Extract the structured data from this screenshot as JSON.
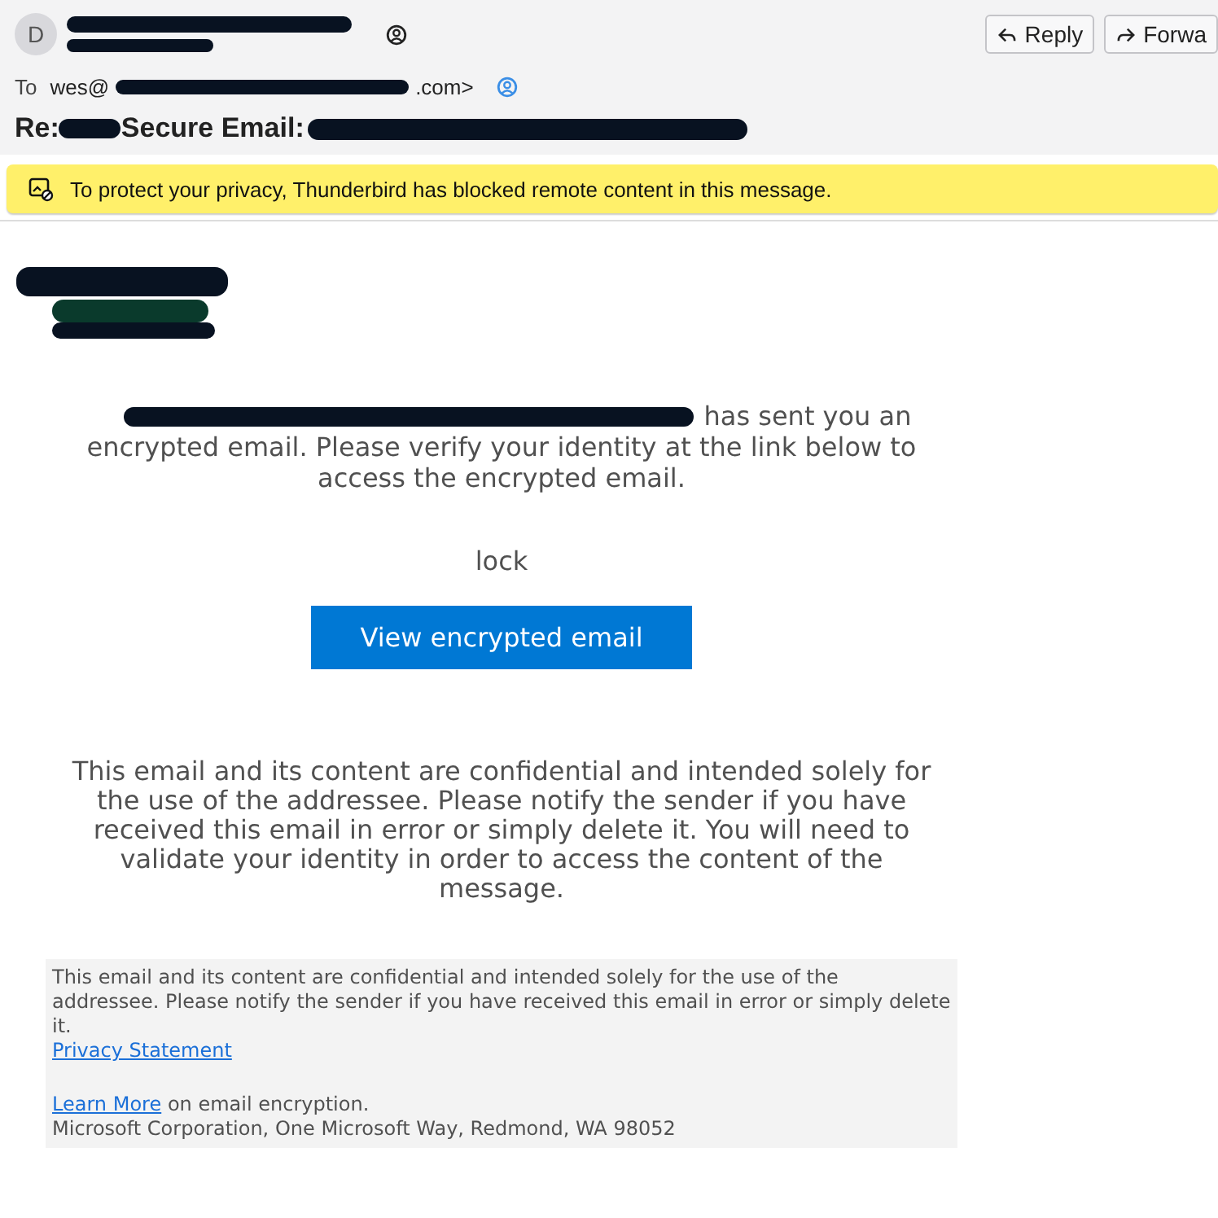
{
  "header": {
    "avatar_initial": "D",
    "to_label": "To",
    "to_start": "wes@",
    "to_end": ".com>",
    "subject_start": "Re:",
    "subject_label": "Secure Email:",
    "buttons": [
      {
        "kind": "reply",
        "label": "Reply"
      },
      {
        "kind": "forward",
        "label": "Forwa"
      }
    ]
  },
  "notification": {
    "text": "To protect your privacy, Thunderbird has blocked remote content in this message."
  },
  "message": {
    "intro_start": "has sent you an",
    "intro_rest": "encrypted email. Please verify your identity at the link below to access the encrypted email.",
    "image_alt": "lock",
    "button": "View encrypted email",
    "notice": "This email and its content are confidential and intended solely for the use of the addressee. Please notify the sender if you have received this email in error or simply delete it. You will need to validate your identity in order to access the content of the message."
  },
  "footer": {
    "disclaimer": "This email and its content are confidential and intended solely for the use of the addressee. Please notify the sender if you have received this email in error or simply delete it.",
    "privacy_link": "Privacy Statement",
    "learn_more_link": "Learn More",
    "learn_more_rest": "on email encryption.",
    "address": "Microsoft Corporation, One Microsoft Way, Redmond, WA 98052"
  }
}
